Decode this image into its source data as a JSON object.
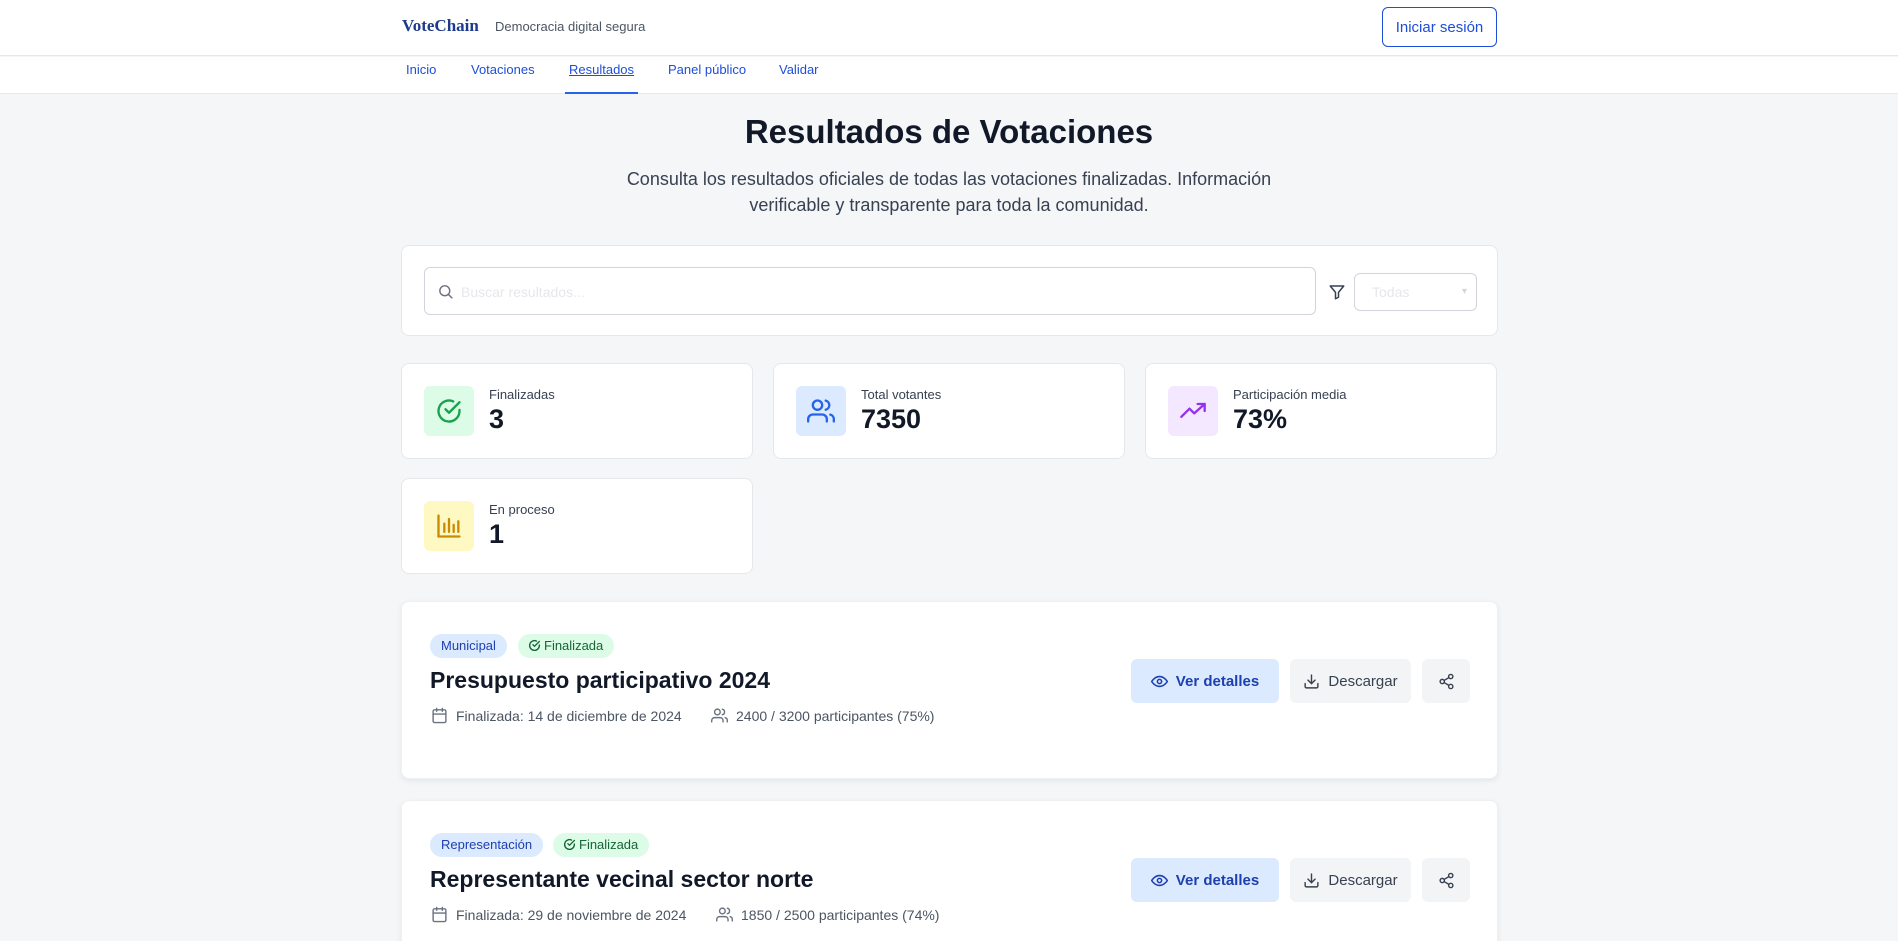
{
  "header": {
    "brand": "VoteChain",
    "tagline": "Democracia digital segura",
    "login_label": "Iniciar sesión"
  },
  "nav": {
    "items": [
      {
        "label": "Inicio"
      },
      {
        "label": "Votaciones"
      },
      {
        "label": "Resultados",
        "active": true
      },
      {
        "label": "Panel público"
      },
      {
        "label": "Validar"
      }
    ]
  },
  "page": {
    "title": "Resultados de Votaciones",
    "description": "Consulta los resultados oficiales de todas las votaciones finalizadas. Información verificable y transparente para toda la comunidad."
  },
  "search": {
    "placeholder": "Buscar resultados...",
    "filter_value": "Todas"
  },
  "stats": [
    {
      "label": "Finalizadas",
      "value": "3",
      "icon": "check-circle-icon",
      "color": "#16a34a",
      "bg": "#dcfce7"
    },
    {
      "label": "Total votantes",
      "value": "7350",
      "icon": "users-icon",
      "color": "#2563eb",
      "bg": "#dbeafe"
    },
    {
      "label": "Participación media",
      "value": "73%",
      "icon": "trending-up-icon",
      "color": "#9333ea",
      "bg": "#f3e8ff"
    },
    {
      "label": "En proceso",
      "value": "1",
      "icon": "bar-chart-icon",
      "color": "#ca8a04",
      "bg": "#fef9c3"
    }
  ],
  "results": [
    {
      "category": "Municipal",
      "status": "Finalizada",
      "title": "Presupuesto participativo 2024",
      "finished": "Finalizada: 14 de diciembre de 2024",
      "participants": "2400 / 3200 participantes (75%)"
    },
    {
      "category": "Representación",
      "status": "Finalizada",
      "title": "Representante vecinal sector norte",
      "finished": "Finalizada: 29 de noviembre de 2024",
      "participants": "1850 / 2500 participantes (74%)"
    }
  ],
  "actions": {
    "view_label": "Ver detalles",
    "download_label": "Descargar"
  },
  "colors": {
    "accent": "#1d4ed8",
    "brand": "#1e3a8a",
    "background": "#f4f6f8"
  }
}
